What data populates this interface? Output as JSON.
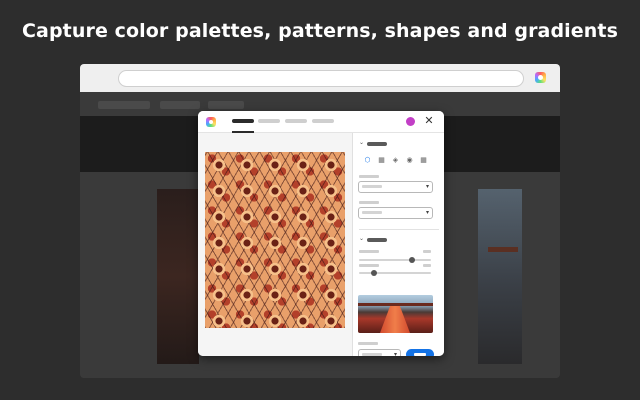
{
  "headline": "Capture color palettes, patterns, shapes and gradients",
  "browser": {
    "address_value": "",
    "extension_icon": "rainbow-ring-icon"
  },
  "dialog": {
    "logo_icon": "rainbow-ring-icon",
    "close_glyph": "✕",
    "pattern_icons": [
      "hexagon-pattern-icon",
      "square-pattern-icon",
      "diamond-pattern-icon",
      "circle-pattern-icon",
      "grid-pattern-icon"
    ],
    "pattern_glyphs": [
      "⬡",
      "▦",
      "◈",
      "◉",
      "▦"
    ],
    "collapse_glyph": "⌄",
    "caret_glyph": "▾",
    "colors": {
      "accent": "#1473e6",
      "user_avatar": "#c23fc6"
    }
  }
}
